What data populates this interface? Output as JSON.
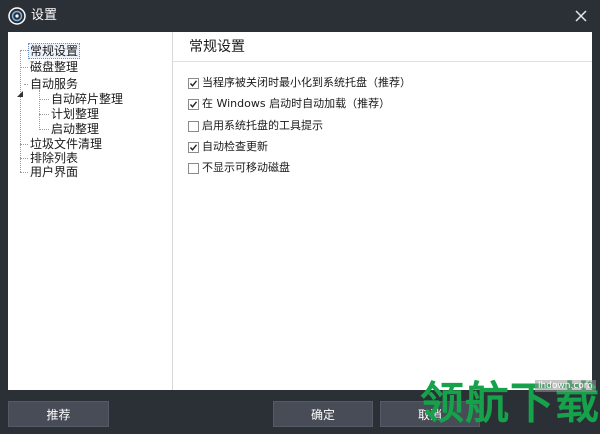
{
  "window": {
    "title": "设置",
    "icon": "app-logo-icon",
    "close_icon": "close-icon"
  },
  "tree": {
    "items": [
      {
        "label": "常规设置",
        "selected": true
      },
      {
        "label": "磁盘整理"
      },
      {
        "label": "自动服务",
        "expanded": true
      },
      {
        "label": "自动碎片整理"
      },
      {
        "label": "计划整理"
      },
      {
        "label": "启动整理"
      },
      {
        "label": "垃圾文件清理"
      },
      {
        "label": "排除列表"
      },
      {
        "label": "用户界面"
      }
    ]
  },
  "pane": {
    "title": "常规设置",
    "options": [
      {
        "label": "当程序被关闭时最小化到系统托盘（推荐）",
        "checked": true
      },
      {
        "label": "在 Windows 启动时自动加载（推荐）",
        "checked": true
      },
      {
        "label": "启用系统托盘的工具提示",
        "checked": false
      },
      {
        "label": "自动检查更新",
        "checked": true
      },
      {
        "label": "不显示可移动磁盘",
        "checked": false
      }
    ]
  },
  "buttons": {
    "recommend": "推荐",
    "ok": "确定",
    "cancel": "取消"
  },
  "watermark": {
    "text": "领航下载",
    "url": "lhdown.com",
    "color": "#15a24a"
  },
  "colors": {
    "frame": "#2b2f36",
    "button": "#474c56",
    "client": "#ffffff"
  }
}
